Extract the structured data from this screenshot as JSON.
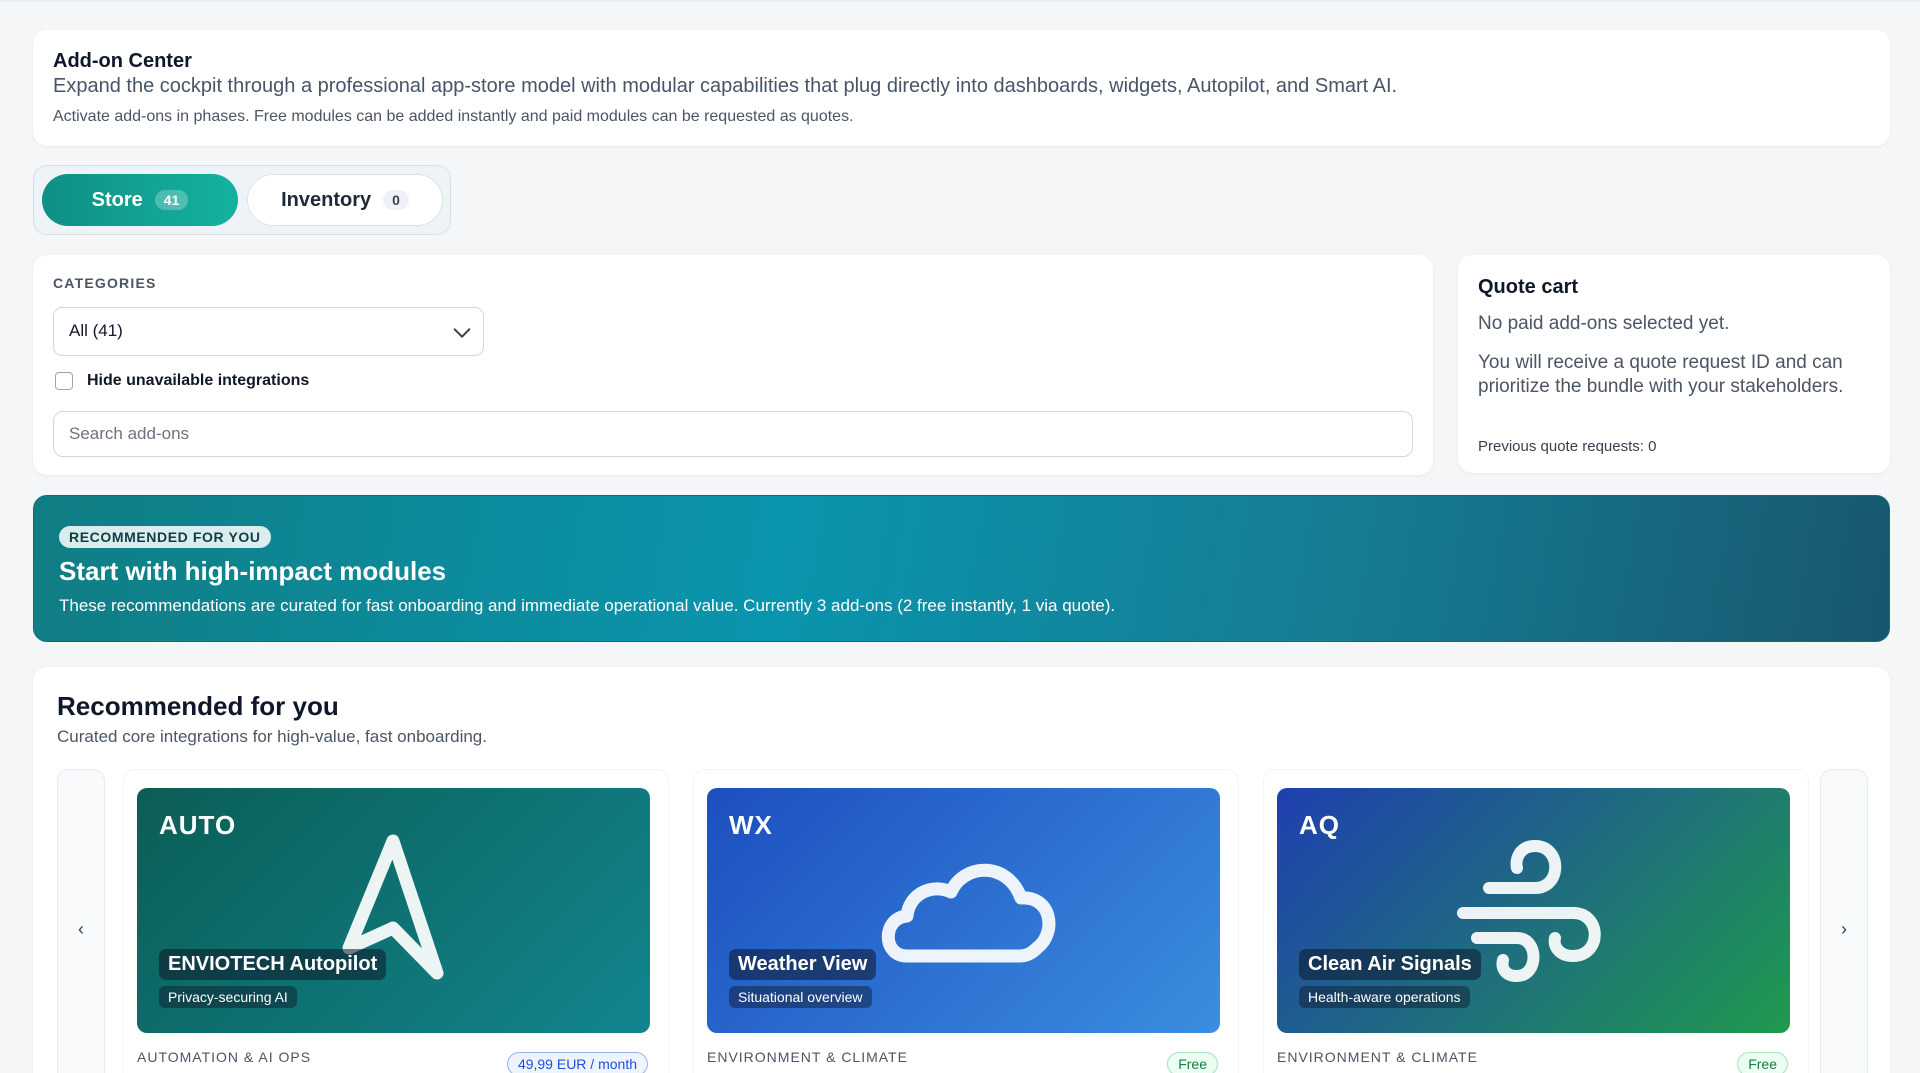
{
  "header": {
    "title": "Add-on Center",
    "subtitle": "Expand the cockpit through a professional app-store model with modular capabilities that plug directly into dashboards, widgets, Autopilot, and Smart AI.",
    "note": "Activate add-ons in phases. Free modules can be added instantly and paid modules can be requested as quotes."
  },
  "tabs": {
    "store": {
      "label": "Store",
      "count": "41"
    },
    "inventory": {
      "label": "Inventory",
      "count": "0"
    }
  },
  "filters": {
    "categories_label": "CATEGORIES",
    "category_selected": "All (41)",
    "hide_unavailable_label": "Hide unavailable integrations",
    "hide_unavailable_checked": false,
    "search_placeholder": "Search add-ons",
    "search_value": ""
  },
  "quote_cart": {
    "title": "Quote cart",
    "empty": "No paid add-ons selected yet.",
    "info": "You will receive a quote request ID and can prioritize the bundle with your stakeholders.",
    "previous": "Previous quote requests: 0"
  },
  "banner": {
    "pill": "RECOMMENDED FOR YOU",
    "title": "Start with high-impact modules",
    "subtitle": "These recommendations are curated for fast onboarding and immediate operational value. Currently 3 add-ons (2 free instantly, 1 via quote)."
  },
  "recommended": {
    "title": "Recommended for you",
    "subtitle": "Curated core integrations for high-value, fast onboarding.",
    "prev_arrow": "‹",
    "next_arrow": "›",
    "cards": [
      {
        "code": "AUTO",
        "name": "ENVIOTECH Autopilot",
        "tag": "Privacy-securing AI",
        "category": "AUTOMATION & AI OPS",
        "price": "49,99 EUR / month",
        "icon": "navigation-arrow-icon",
        "gradient": [
          "#0b5e55",
          "#12858f"
        ]
      },
      {
        "code": "WX",
        "name": "Weather View",
        "tag": "Situational overview",
        "category": "ENVIRONMENT & CLIMATE",
        "price": "Free",
        "icon": "cloud-icon",
        "gradient": [
          "#1d4fbf",
          "#3b8ee0"
        ]
      },
      {
        "code": "AQ",
        "name": "Clean Air Signals",
        "tag": "Health-aware operations",
        "category": "ENVIRONMENT & CLIMATE",
        "price": "Free",
        "icon": "wind-icon",
        "gradient": [
          "#1f3fb0",
          "#1f9a4e"
        ]
      }
    ]
  }
}
